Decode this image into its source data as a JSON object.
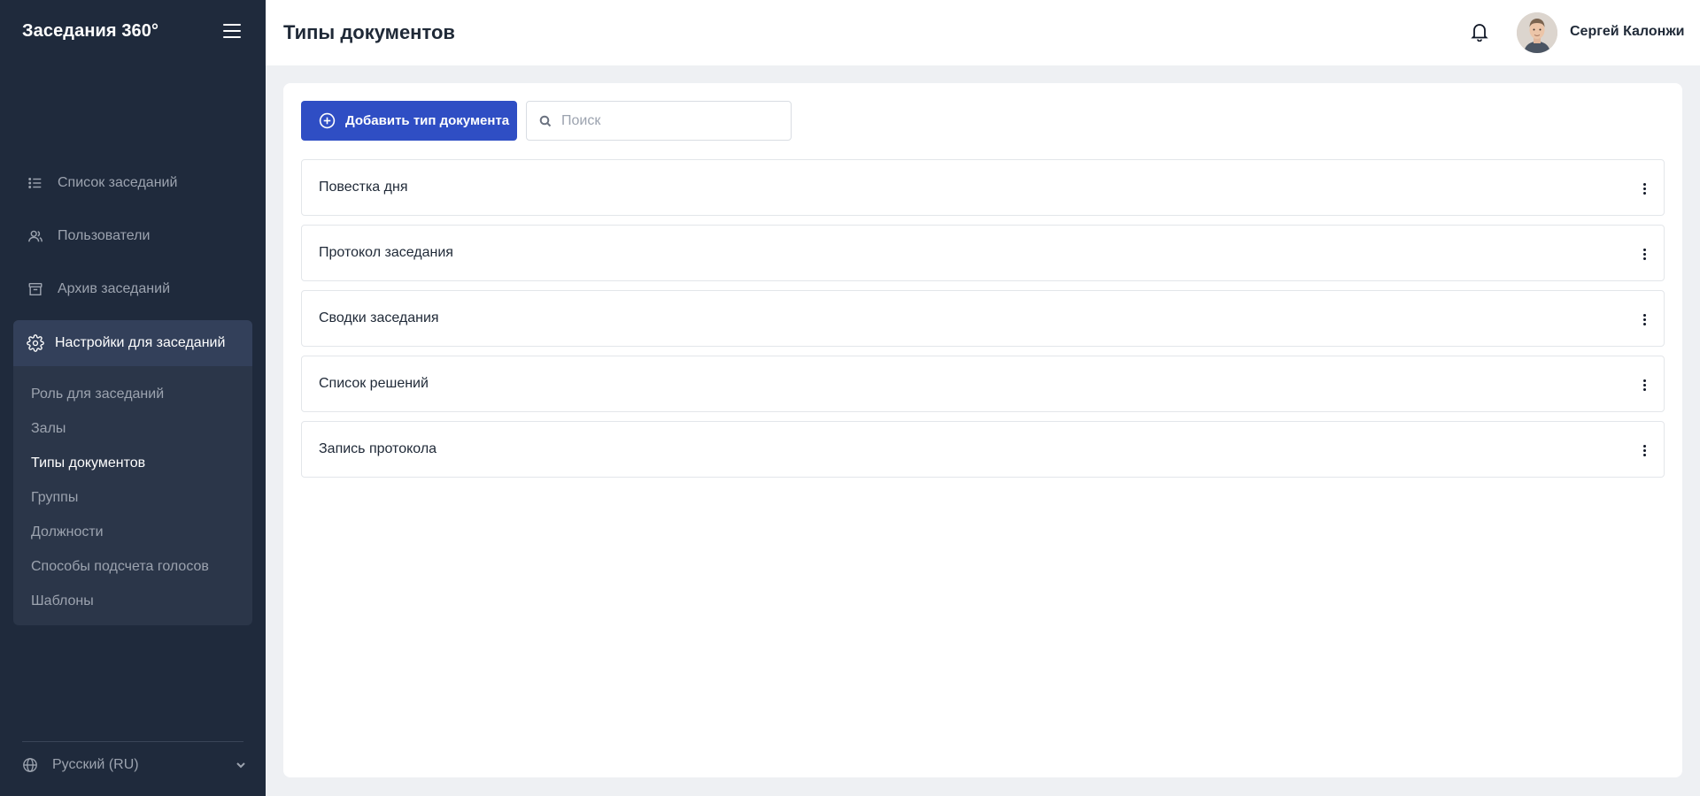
{
  "app": {
    "title": "Заседания 360°"
  },
  "sidebar": {
    "nav": [
      {
        "label": "Список заседаний",
        "icon": "list-icon"
      },
      {
        "label": "Пользователи",
        "icon": "users-icon"
      },
      {
        "label": "Архив заседаний",
        "icon": "archive-icon"
      }
    ],
    "settings": {
      "label": "Настройки для заседаний",
      "icon": "gear-icon",
      "items": [
        {
          "label": "Роль для заседаний",
          "active": false
        },
        {
          "label": "Залы",
          "active": false
        },
        {
          "label": "Типы документов",
          "active": true
        },
        {
          "label": "Группы",
          "active": false
        },
        {
          "label": "Должности",
          "active": false
        },
        {
          "label": "Способы подсчета голосов",
          "active": false
        },
        {
          "label": "Шаблоны",
          "active": false
        }
      ]
    },
    "language": {
      "label": "Русский (RU)",
      "icon": "globe-icon"
    }
  },
  "header": {
    "title": "Типы документов",
    "user_name": "Сергей Калонжи"
  },
  "main": {
    "add_button_label": "Добавить тип документа",
    "search_placeholder": "Поиск",
    "document_types": [
      "Повестка дня",
      "Протокол заседания",
      "Сводки заседания",
      "Список решений",
      "Запись протокола"
    ]
  },
  "colors": {
    "sidebar_bg": "#1f2a3c",
    "accent": "#2f4ec4",
    "page_bg": "#eef0f3"
  }
}
